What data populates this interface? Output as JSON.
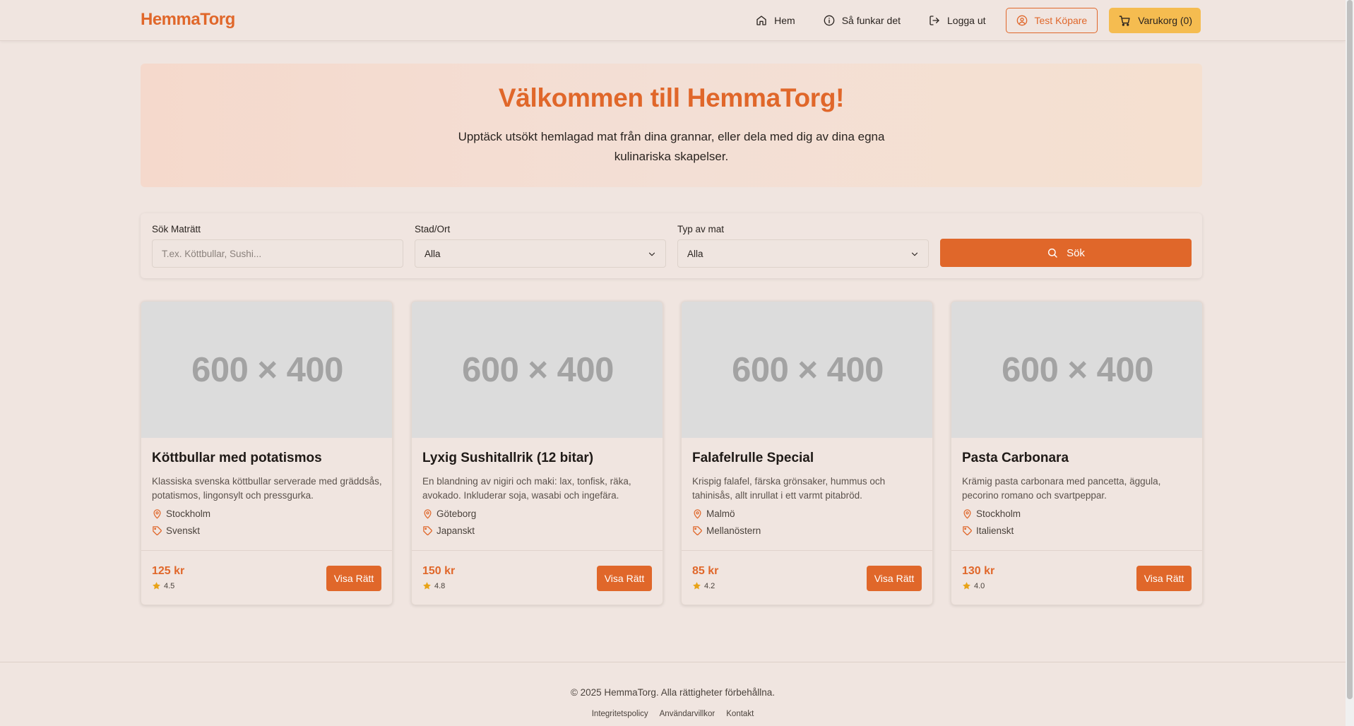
{
  "header": {
    "logo": "HemmaTorg",
    "nav": {
      "home": "Hem",
      "how_it_works": "Så funkar det",
      "logout": "Logga ut",
      "user": "Test Köpare",
      "cart": "Varukorg (0)"
    }
  },
  "hero": {
    "title": "Välkommen till HemmaTorg!",
    "subtitle_line1": "Upptäck utsökt hemlagad mat från dina grannar, eller dela med dig av dina egna",
    "subtitle_line2": "kulinariska skapelser."
  },
  "search": {
    "dish_label": "Sök Maträtt",
    "dish_placeholder": "T.ex. Köttbullar, Sushi...",
    "city_label": "Stad/Ort",
    "city_value": "Alla",
    "type_label": "Typ av mat",
    "type_value": "Alla",
    "button": "Sök"
  },
  "dishes": [
    {
      "image_text": "600 × 400",
      "title": "Köttbullar med potatismos",
      "description": "Klassiska svenska köttbullar serverade med gräddsås, potatismos, lingonsylt och pressgurka.",
      "city": "Stockholm",
      "cuisine": "Svenskt",
      "price": "125 kr",
      "rating": "4.5",
      "button": "Visa Rätt"
    },
    {
      "image_text": "600 × 400",
      "title": "Lyxig Sushitallrik (12 bitar)",
      "description": "En blandning av nigiri och maki: lax, tonfisk, räka, avokado. Inkluderar soja, wasabi och ingefära.",
      "city": "Göteborg",
      "cuisine": "Japanskt",
      "price": "150 kr",
      "rating": "4.8",
      "button": "Visa Rätt"
    },
    {
      "image_text": "600 × 400",
      "title": "Falafelrulle Special",
      "description": "Krispig falafel, färska grönsaker, hummus och tahinisås, allt inrullat i ett varmt pitabröd.",
      "city": "Malmö",
      "cuisine": "Mellanöstern",
      "price": "85 kr",
      "rating": "4.2",
      "button": "Visa Rätt"
    },
    {
      "image_text": "600 × 400",
      "title": "Pasta Carbonara",
      "description": "Krämig pasta carbonara med pancetta, äggula, pecorino romano och svartpeppar.",
      "city": "Stockholm",
      "cuisine": "Italienskt",
      "price": "130 kr",
      "rating": "4.0",
      "button": "Visa Rätt"
    }
  ],
  "footer": {
    "copyright": "© 2025 HemmaTorg. Alla rättigheter förbehållna.",
    "links": [
      "Integritetspolicy",
      "Användarvillkor",
      "Kontakt"
    ]
  },
  "colors": {
    "accent": "#e0672a",
    "cart": "#f5bc50",
    "background": "#f0e5e0",
    "star": "#e8a317"
  }
}
